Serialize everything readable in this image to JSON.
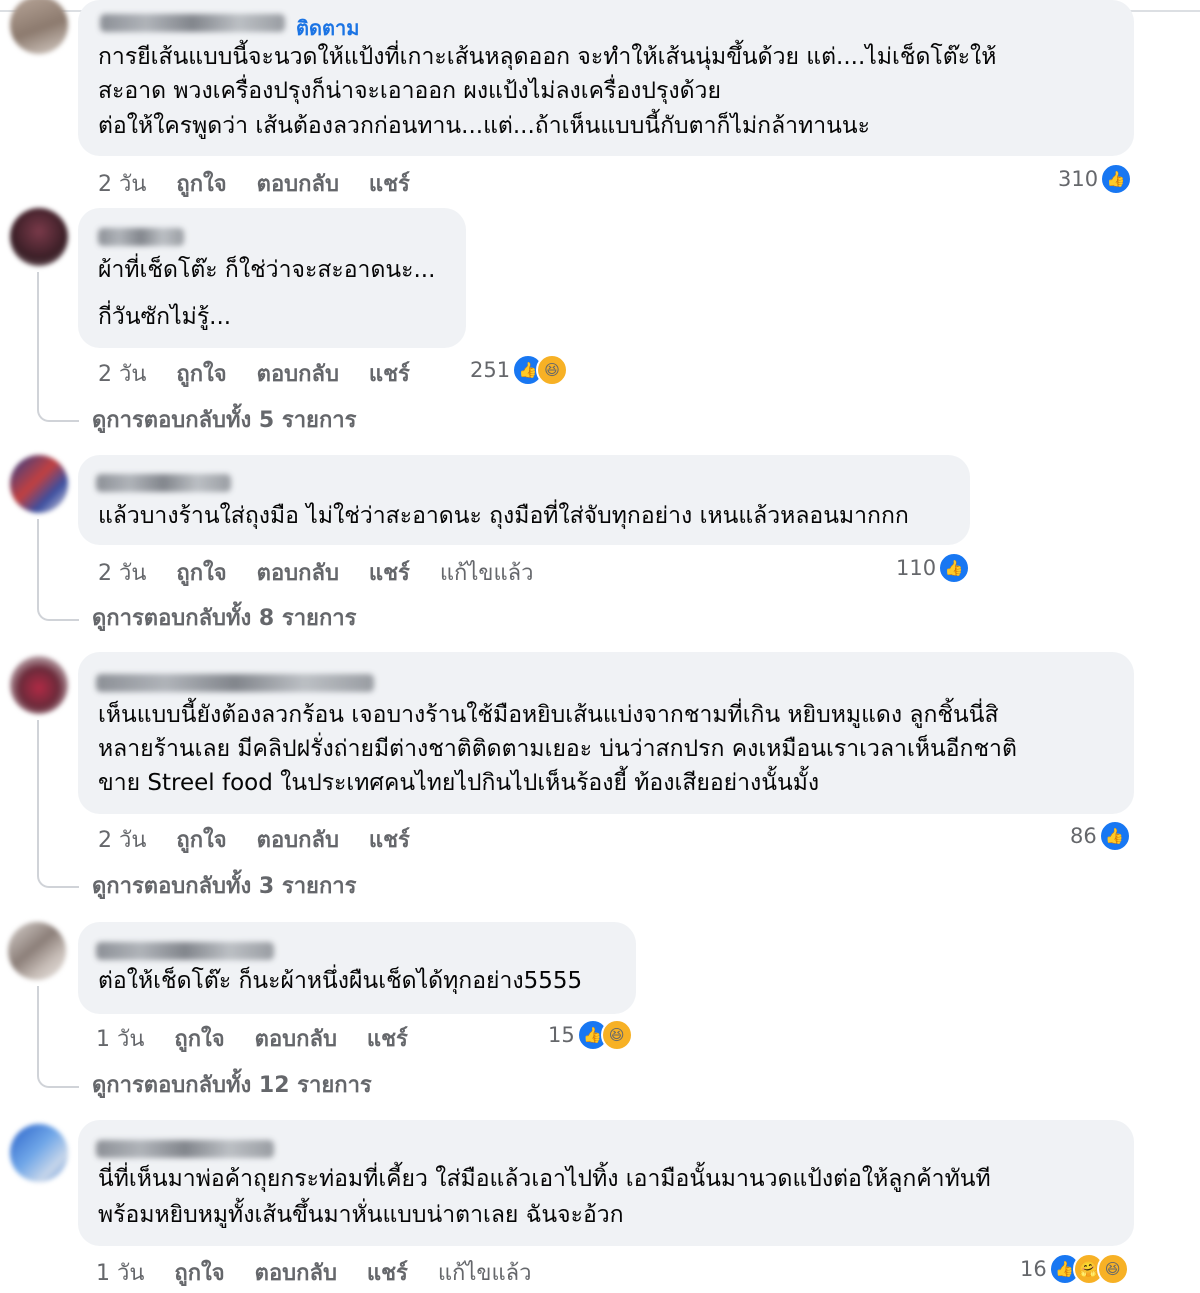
{
  "comments": [
    {
      "follow": "ติดตาม",
      "lines": [
        "การยีเส้นแบบนี้จะนวดให้แป้งที่เกาะเส้นหลุดออก จะทำให้เส้นนุ่มขึ้นด้วย แต่....ไม่เช็ดโต๊ะให้",
        "สะอาด พวงเครื่องปรุงก็น่าจะเอาออก ผงแป้งไม่ลงเครื่องปรุงด้วย",
        "ต่อให้ใครพูดว่า เส้นต้องลวกก่อนทาน...แต่...ถ้าเห็นแบบนี้กับตาก็ไม่กล้าทานนะ"
      ],
      "time": "2 วัน",
      "like": "ถูกใจ",
      "reply": "ตอบกลับ",
      "share": "แชร์",
      "reaction_count": "310"
    },
    {
      "lines": [
        "ผ้าที่เช็ดโต๊ะ ก็ใช่ว่าจะสะอาดนะ...",
        "กี่วันซักไม่รู้..."
      ],
      "time": "2 วัน",
      "like": "ถูกใจ",
      "reply": "ตอบกลับ",
      "share": "แชร์",
      "reaction_count": "251",
      "view_replies": "ดูการตอบกลับทั้ง 5 รายการ"
    },
    {
      "lines": [
        "แล้วบางร้านใส่ถุงมือ ไม่ใช่ว่าสะอาดนะ ถุงมือที่ใส่จับทุกอย่าง เหนแล้วหลอนมากกก"
      ],
      "time": "2 วัน",
      "like": "ถูกใจ",
      "reply": "ตอบกลับ",
      "share": "แชร์",
      "edited": "แก้ไขแล้ว",
      "reaction_count": "110",
      "view_replies": "ดูการตอบกลับทั้ง 8 รายการ"
    },
    {
      "lines": [
        "เห็นแบบนี้ยังต้องลวกร้อน เจอบางร้านใช้มือหยิบเส้นแบ่งจากชามที่เกิน หยิบหมูแดง ลูกชิ้นนี่สิ",
        "หลายร้านเลย มีคลิปฝรั่งถ่ายมีต่างชาติติดตามเยอะ บ่นว่าสกปรก คงเหมือนเราเวลาเห็นอีกชาติ",
        "ขาย Streel food ในประเทศคนไทยไปกินไปเห็นร้องยี้ ท้องเสียอย่างนั้นมั้ง"
      ],
      "time": "2 วัน",
      "like": "ถูกใจ",
      "reply": "ตอบกลับ",
      "share": "แชร์",
      "reaction_count": "86",
      "view_replies": "ดูการตอบกลับทั้ง 3 รายการ"
    },
    {
      "lines": [
        "ต่อให้เช็ดโต๊ะ ก็นะผ้าหนึ่งผืนเช็ดได้ทุกอย่าง5555"
      ],
      "time": "1 วัน",
      "like": "ถูกใจ",
      "reply": "ตอบกลับ",
      "share": "แชร์",
      "reaction_count": "15",
      "view_replies": "ดูการตอบกลับทั้ง 12 รายการ"
    },
    {
      "lines": [
        "นี่ที่เห็นมาพ่อค้าถุยกระท่อมที่เคี้ยว ใส่มือแล้วเอาไปทิ้ง เอามือนั้นมานวดแป้งต่อให้ลูกค้าทันที",
        "พร้อมหยิบหมูทั้งเส้นขึ้นมาหั่นแบบน่าตาเลย ฉันจะอ้วก"
      ],
      "time": "1 วัน",
      "like": "ถูกใจ",
      "reply": "ตอบกลับ",
      "share": "แชร์",
      "edited": "แก้ไขแล้ว",
      "reaction_count": "16"
    }
  ],
  "icons": {
    "like": "like-icon",
    "haha": "haha-icon",
    "care": "care-icon"
  },
  "colors": {
    "accent": "#1b74e4",
    "bubble": "#f0f2f5",
    "meta": "#65676b",
    "like_blue": "#1877f2"
  }
}
